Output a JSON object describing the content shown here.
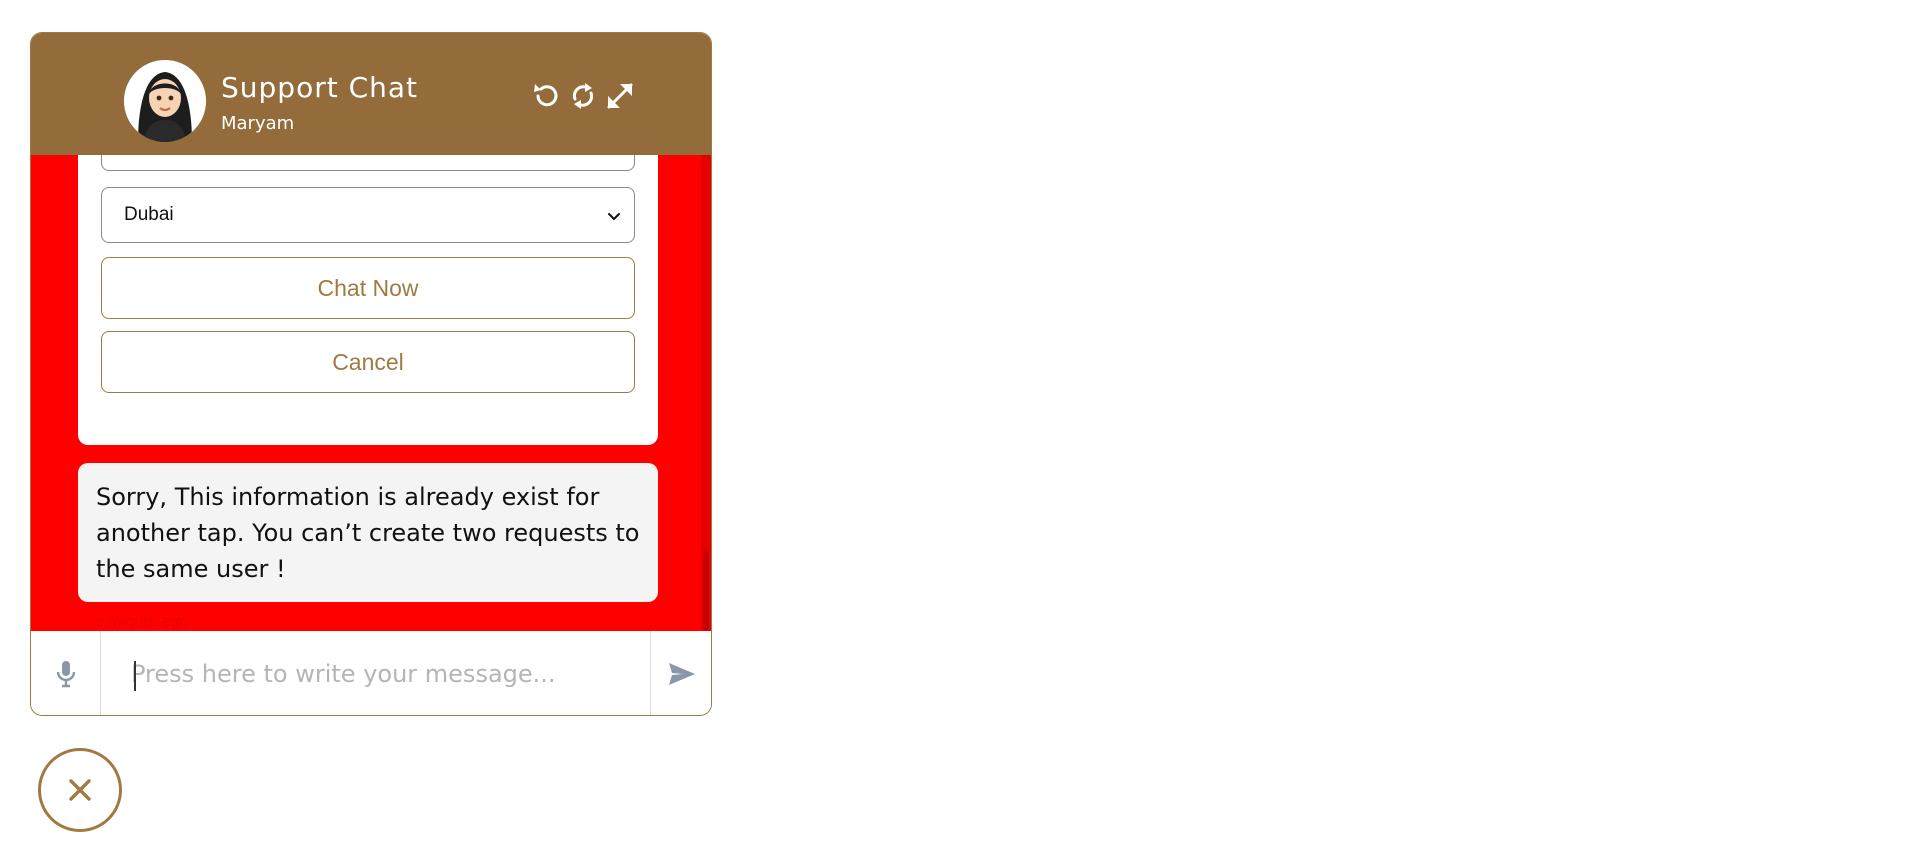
{
  "header": {
    "title": "Support Chat",
    "agent_name": "Maryam",
    "icons": [
      "undo-icon",
      "refresh-icon",
      "expand-icon"
    ]
  },
  "form": {
    "city_select": {
      "selected": "Dubai"
    },
    "chat_now_label": "Chat Now",
    "cancel_label": "Cancel"
  },
  "messages": [
    {
      "text": "Sorry, This information is already exist for another tap. You can’t create two requests to the same user !",
      "time": "a minute ago"
    }
  ],
  "composer": {
    "placeholder": "Press here to write your message..."
  },
  "colors": {
    "brand": "#946c3b",
    "accent": "#a07a42",
    "body_background": "#ff0000",
    "bubble": "#f4f4f4"
  }
}
